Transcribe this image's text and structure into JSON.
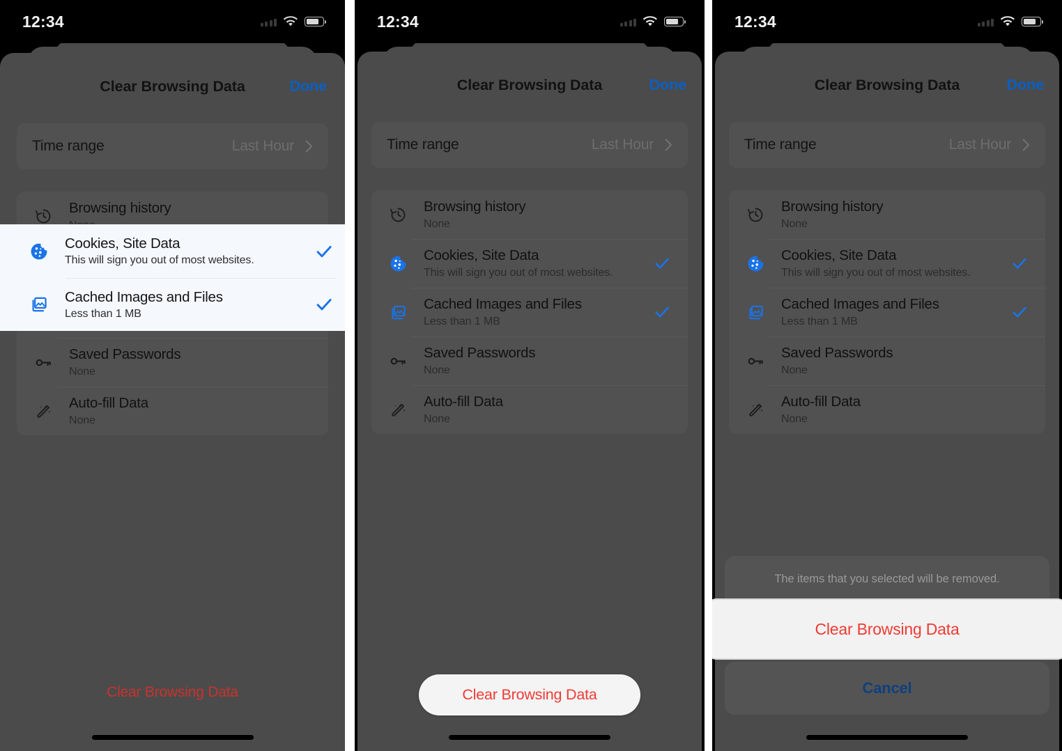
{
  "statusbar": {
    "time": "12:34",
    "signal_icon": "signal-dots-icon",
    "wifi_icon": "wifi-icon",
    "battery_icon": "battery-icon"
  },
  "sheet": {
    "title": "Clear Browsing Data",
    "done_label": "Done"
  },
  "time_range": {
    "label": "Time range",
    "value": "Last Hour",
    "chevron_icon": "chevron-right-icon"
  },
  "items": [
    {
      "icon": "history-clock-icon",
      "title": "Browsing history",
      "subtitle": "None",
      "checked": false
    },
    {
      "icon": "cookie-icon",
      "title": "Cookies, Site Data",
      "subtitle": "This will sign you out of most websites.",
      "checked": true
    },
    {
      "icon": "cached-images-icon",
      "title": "Cached Images and Files",
      "subtitle": "Less than 1 MB",
      "checked": true
    },
    {
      "icon": "key-icon",
      "title": "Saved Passwords",
      "subtitle": "None",
      "checked": false
    },
    {
      "icon": "magic-wand-icon",
      "title": "Auto-fill Data",
      "subtitle": "None",
      "checked": false
    }
  ],
  "bottom_button": {
    "label": "Clear Browsing Data"
  },
  "action_sheet": {
    "message": "The items that you selected will be removed.",
    "destructive_label": "Clear Browsing Data",
    "cancel_label": "Cancel"
  },
  "colors": {
    "accent_blue": "#1a73e8",
    "done_blue": "#0a5fc4",
    "destructive_red": "#ef3b34",
    "cancel_blue": "#10407e",
    "sheet_gray": "#4b4b4b",
    "card_gray": "#515151",
    "highlight_bg": "#f5f9fe"
  }
}
